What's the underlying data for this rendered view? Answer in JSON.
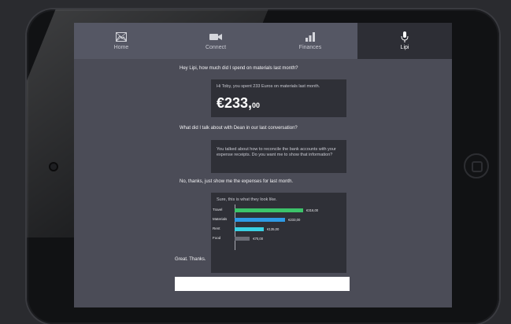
{
  "nav": {
    "tabs": [
      {
        "label": "Home",
        "icon": "image-icon"
      },
      {
        "label": "Connect",
        "icon": "video-camera-icon"
      },
      {
        "label": "Finances",
        "icon": "bar-chart-icon"
      },
      {
        "label": "Lipi",
        "icon": "microphone-icon",
        "active": true
      }
    ]
  },
  "chat": {
    "q1": "Hey Lipi, how much did I spend on materials last month?",
    "a1_text": "Hi Toby, you spent 233 Euros on materials last month.",
    "a1_amount_main": "€233,",
    "a1_amount_cents": "00",
    "q2": "What did I talk about with Dean in our last conversation?",
    "a2_text": "You talked about how to reconcile the bank accounts with your expense receipts. Do you want me to show that information?",
    "q3": "No, thanks, just show me the expenses for last month.",
    "a3_text": "Sure, this is what they look like.",
    "q4": "Great. Thanks."
  },
  "chart_data": {
    "type": "bar",
    "orientation": "horizontal",
    "categories": [
      "Travel",
      "Materials",
      "Rent",
      "Food"
    ],
    "values": [
      316,
      233,
      135,
      70
    ],
    "value_labels": [
      "€316,00",
      "€233,00",
      "€135,00",
      "€70,00"
    ],
    "colors": [
      "#3cc36a",
      "#2e9be6",
      "#3ad0e3",
      "#6b6d76"
    ],
    "title": "",
    "xlabel": "",
    "ylabel": "",
    "xlim": [
      0,
      316
    ]
  },
  "input": {
    "value": "",
    "placeholder": ""
  }
}
